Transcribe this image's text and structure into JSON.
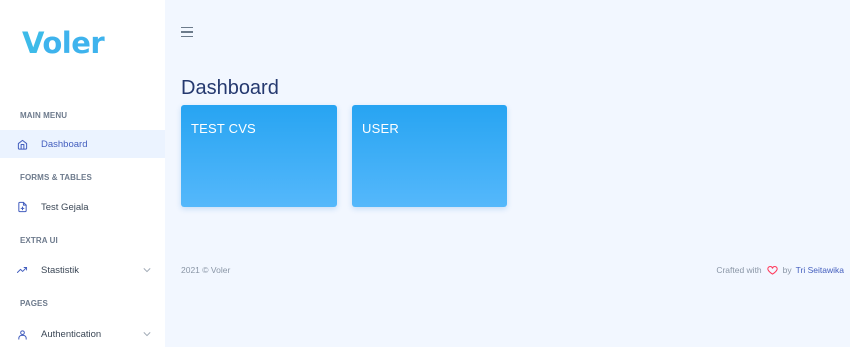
{
  "sidebar": {
    "brand": {
      "first": "V",
      "rest": "oler"
    },
    "sections": [
      {
        "title": "MAIN MENU"
      },
      {
        "title": "FORMS & TABLES"
      },
      {
        "title": "EXTRA UI"
      },
      {
        "title": "PAGES"
      }
    ],
    "items": [
      {
        "label": "Dashboard",
        "icon": "home-icon",
        "active": true
      },
      {
        "label": "Test Gejala",
        "icon": "file-plus-icon",
        "active": false
      },
      {
        "label": "Stastistik",
        "icon": "trending-up-icon",
        "active": false,
        "has_submenu": true
      },
      {
        "label": "Authentication",
        "icon": "user-icon",
        "active": false,
        "has_submenu": true
      }
    ]
  },
  "header": {
    "menu_icon": "hamburger-icon"
  },
  "main": {
    "title": "Dashboard",
    "cards": [
      {
        "title": "TEST CVS"
      },
      {
        "title": "USER"
      }
    ]
  },
  "footer": {
    "copyright": "2021 © Voler",
    "crafted": "Crafted with",
    "by": "by",
    "author": "Tri Seitawika"
  },
  "colors": {
    "accent": "#435ebe",
    "brand": "#3eb3ed",
    "card_gradient_top": "#27a4f2",
    "card_gradient_bottom": "#55b8fb",
    "heart": "#ff3a5c"
  }
}
